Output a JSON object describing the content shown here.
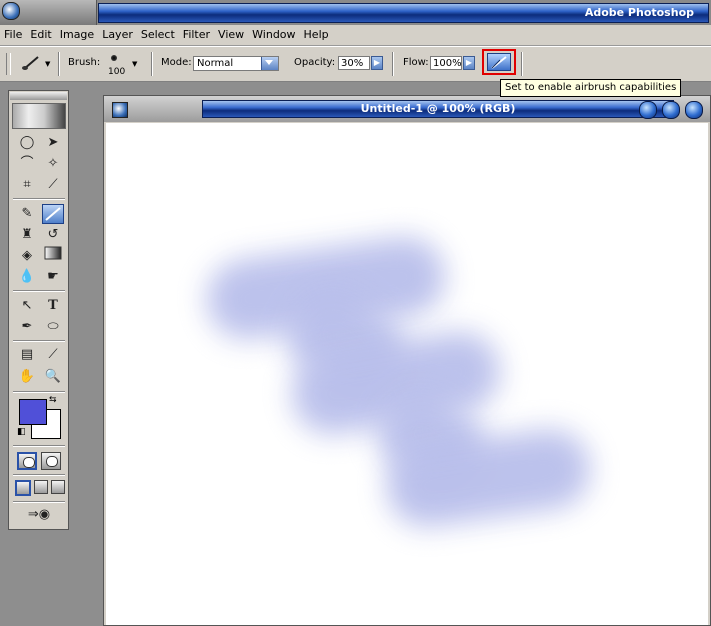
{
  "app": {
    "title": "Adobe Photoshop"
  },
  "menu": {
    "items": [
      "File",
      "Edit",
      "Image",
      "Layer",
      "Select",
      "Filter",
      "View",
      "Window",
      "Help"
    ]
  },
  "options_bar": {
    "brush_label": "Brush:",
    "brush_size": "100",
    "mode_label": "Mode:",
    "mode_value": "Normal",
    "opacity_label": "Opacity:",
    "opacity_value": "30%",
    "flow_label": "Flow:",
    "flow_value": "100%",
    "airbrush_tooltip": "Set to enable airbrush capabilities"
  },
  "toolbox": {
    "foreground_color": "#5050d8",
    "background_color": "#ffffff",
    "tools": [
      "rectangular-marquee",
      "move",
      "lasso",
      "magic-wand",
      "crop",
      "slice",
      "healing-brush",
      "brush",
      "clone-stamp",
      "history-brush",
      "eraser",
      "gradient",
      "blur",
      "dodge",
      "path-selection",
      "type",
      "pen",
      "shape",
      "notes",
      "eyedropper",
      "hand",
      "zoom"
    ]
  },
  "document": {
    "title": "Untitled-1 @ 100% (RGB)",
    "stroke_color": "#b9bfeb"
  },
  "colors": {
    "title_bar": "#1b4aa8",
    "tooltip_bg": "#ffffe1",
    "highlight_border": "#e00000",
    "chrome": "#d4d0c8"
  }
}
